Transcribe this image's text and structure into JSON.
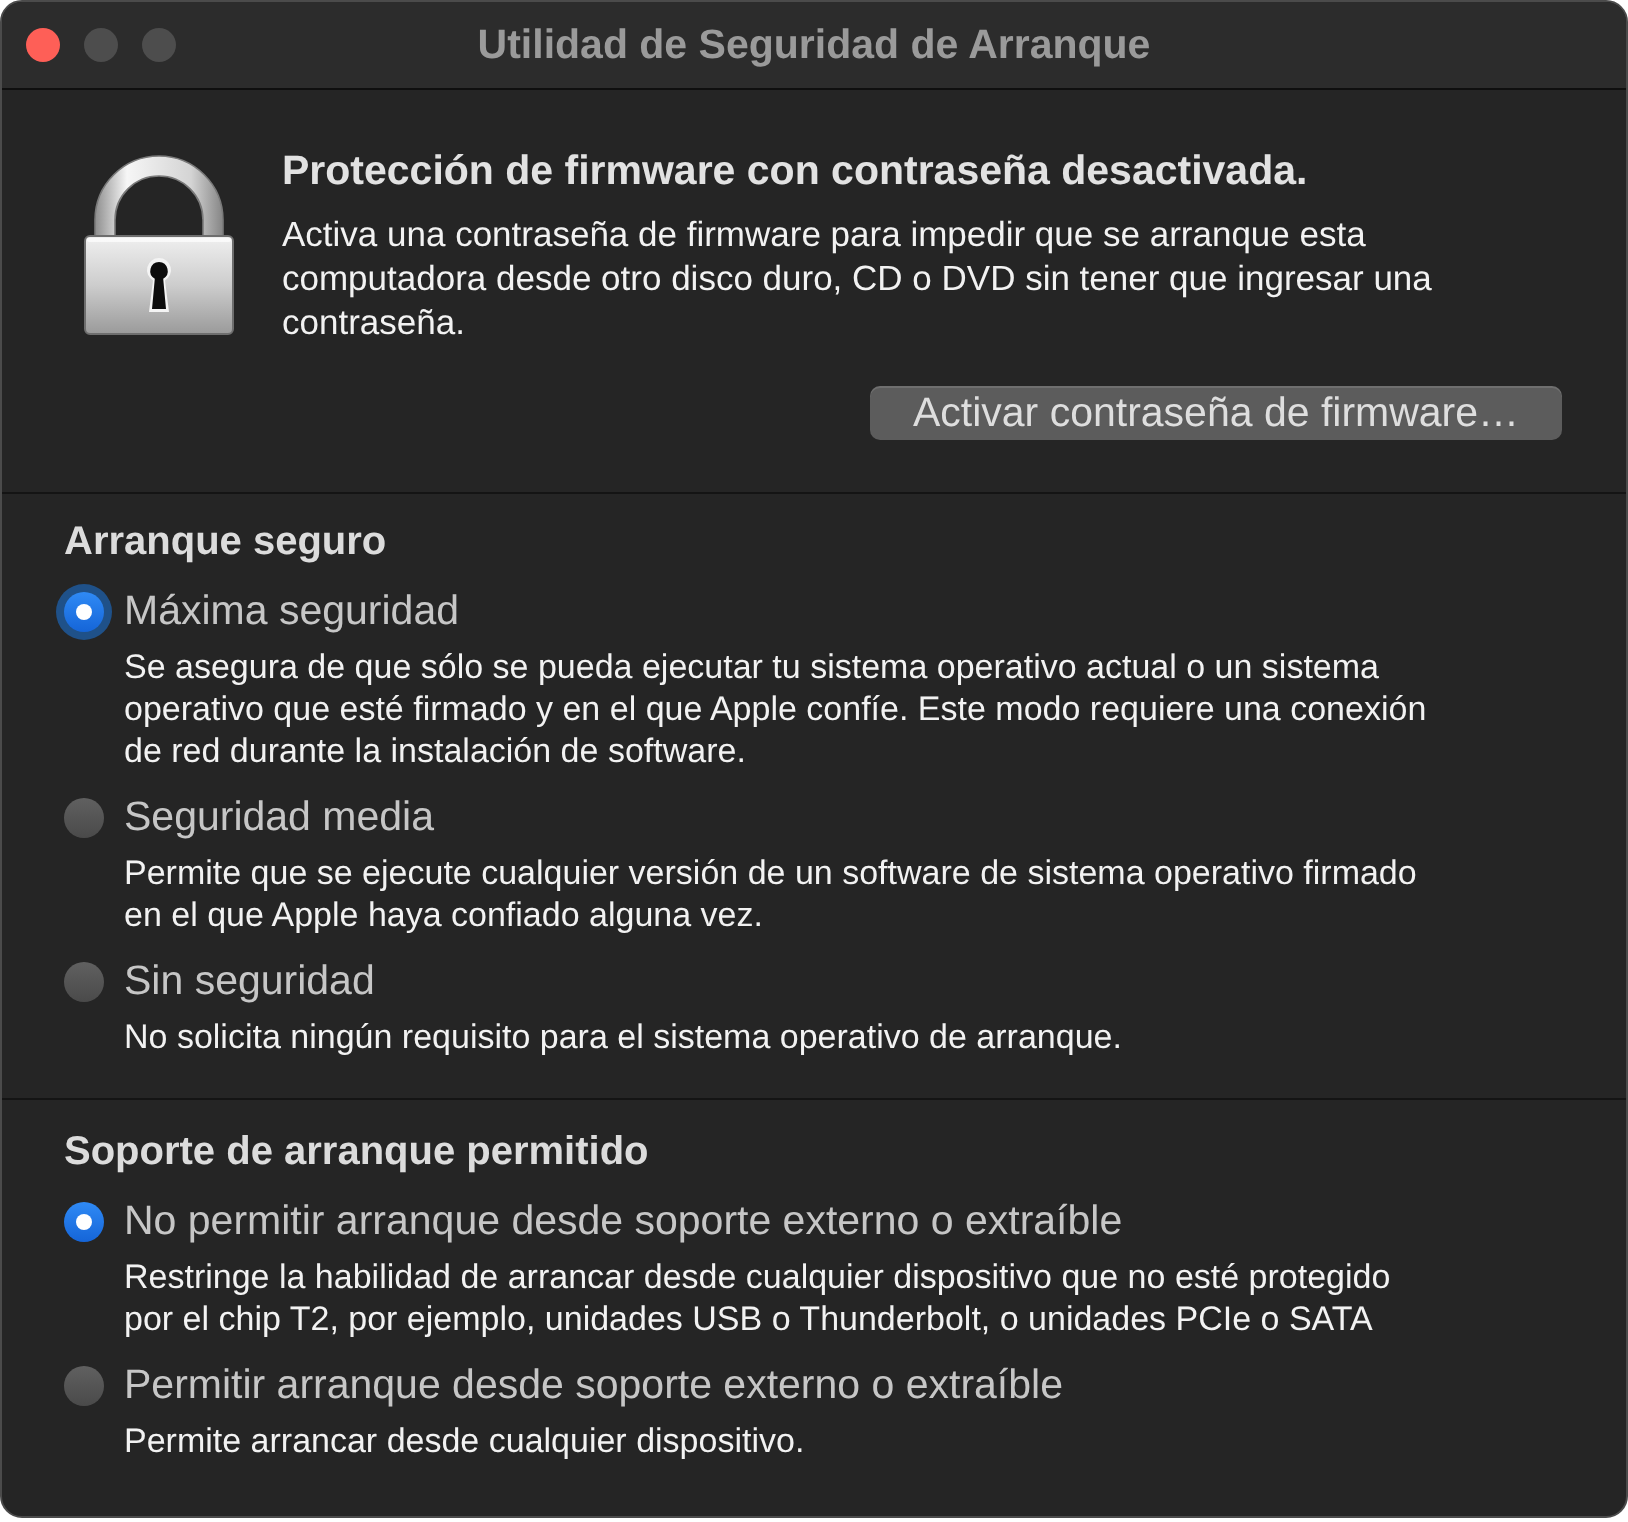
{
  "window": {
    "title": "Utilidad de Seguridad de Arranque",
    "controls": [
      {
        "kind": "close",
        "disabled": false
      },
      {
        "kind": "minimize",
        "disabled": true
      },
      {
        "kind": "zoom",
        "disabled": true
      }
    ]
  },
  "firmware": {
    "heading": "Protección de firmware con contraseña desactivada.",
    "description": "Activa una contraseña de firmware para impedir que se arranque esta computadora desde otro disco duro, CD o DVD sin tener que ingresar una contraseña.",
    "button": "Activar contraseña de firmware…"
  },
  "sections": [
    {
      "title": "Arranque seguro",
      "options": [
        {
          "label": "Máxima seguridad",
          "description": "Se asegura de que sólo se pueda ejecutar tu sistema operativo actual o un sistema operativo que esté firmado y en el que Apple confíe. Este modo requiere una conexión de red durante la instalación de software.",
          "selected": true,
          "focused": true
        },
        {
          "label": "Seguridad media",
          "description": "Permite que se ejecute cualquier versión de un software de sistema operativo firmado en el que Apple haya confiado alguna vez.",
          "selected": false,
          "focused": false
        },
        {
          "label": "Sin seguridad",
          "description": "No solicita ningún requisito para el sistema operativo de arranque.",
          "selected": false,
          "focused": false
        }
      ]
    },
    {
      "title": "Soporte de arranque permitido",
      "options": [
        {
          "label": "No permitir arranque desde soporte externo o extraíble",
          "description": "Restringe la habilidad de arrancar desde cualquier dispositivo que no esté protegido por el chip T2, por ejemplo, unidades USB o Thunderbolt, o unidades PCIe o SATA",
          "selected": true,
          "focused": false
        },
        {
          "label": "Permitir arranque desde soporte externo o extraíble",
          "description": "Permite arrancar desde cualquier dispositivo.",
          "selected": false,
          "focused": false
        }
      ]
    }
  ]
}
